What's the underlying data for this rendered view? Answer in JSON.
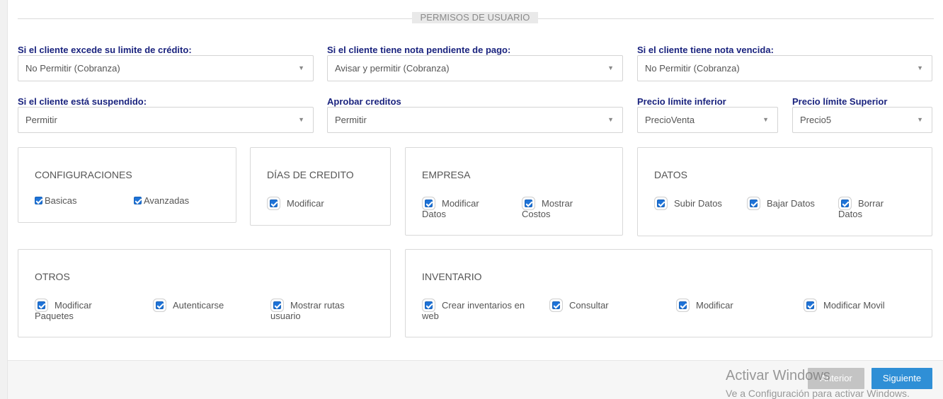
{
  "section_title": "PERMISOS DE USUARIO",
  "fields": {
    "limite_credito": {
      "label": "Si el cliente excede su limite de crédito:",
      "value": "No Permitir (Cobranza)"
    },
    "nota_pendiente": {
      "label": "Si el cliente tiene nota pendiente de pago:",
      "value": "Avisar y permitir (Cobranza)"
    },
    "nota_vencida": {
      "label": "Si el cliente tiene nota vencida:",
      "value": "No Permitir (Cobranza)"
    },
    "suspendido": {
      "label": "Si el cliente está suspendido:",
      "value": "Permitir"
    },
    "aprobar_creditos": {
      "label": "Aprobar creditos",
      "value": "Permitir"
    },
    "precio_inferior": {
      "label": "Precio límite inferior",
      "value": "PrecioVenta"
    },
    "precio_superior": {
      "label": "Precio límite Superior",
      "value": "Precio5"
    }
  },
  "caret": "▼",
  "groups": {
    "configuraciones": {
      "title": "CONFIGURACIONES",
      "items": [
        "Basicas",
        "Avanzadas"
      ]
    },
    "dias_credito": {
      "title": "DÍAS DE CREDITO",
      "items": [
        "Modificar"
      ]
    },
    "empresa": {
      "title": "EMPRESA",
      "items": [
        [
          "Modificar",
          "Datos"
        ],
        [
          "Mostrar",
          "Costos"
        ]
      ]
    },
    "datos": {
      "title": "DATOS",
      "items": [
        [
          "Subir Datos"
        ],
        [
          "Bajar Datos"
        ],
        [
          "Borrar",
          "Datos"
        ]
      ]
    },
    "otros": {
      "title": "OTROS",
      "items": [
        [
          "Modificar",
          "Paquetes"
        ],
        [
          "Autenticarse"
        ],
        [
          "Mostrar rutas",
          "usuario"
        ]
      ]
    },
    "inventario": {
      "title": "INVENTARIO",
      "items": [
        [
          "Crear inventarios en",
          "web"
        ],
        [
          "Consultar"
        ],
        [
          "Modificar"
        ],
        [
          "Modificar Movil"
        ]
      ]
    }
  },
  "footer": {
    "prev": "Anterior",
    "next": "Siguiente",
    "watermark_title": "Activar Windows",
    "watermark_sub": "Ve a Configuración para activar Windows."
  },
  "colors": {
    "label": "#1a237e",
    "checkbox": "#1e73d8",
    "next_button": "#2f8fd6",
    "prev_button": "#c4c4c4"
  }
}
